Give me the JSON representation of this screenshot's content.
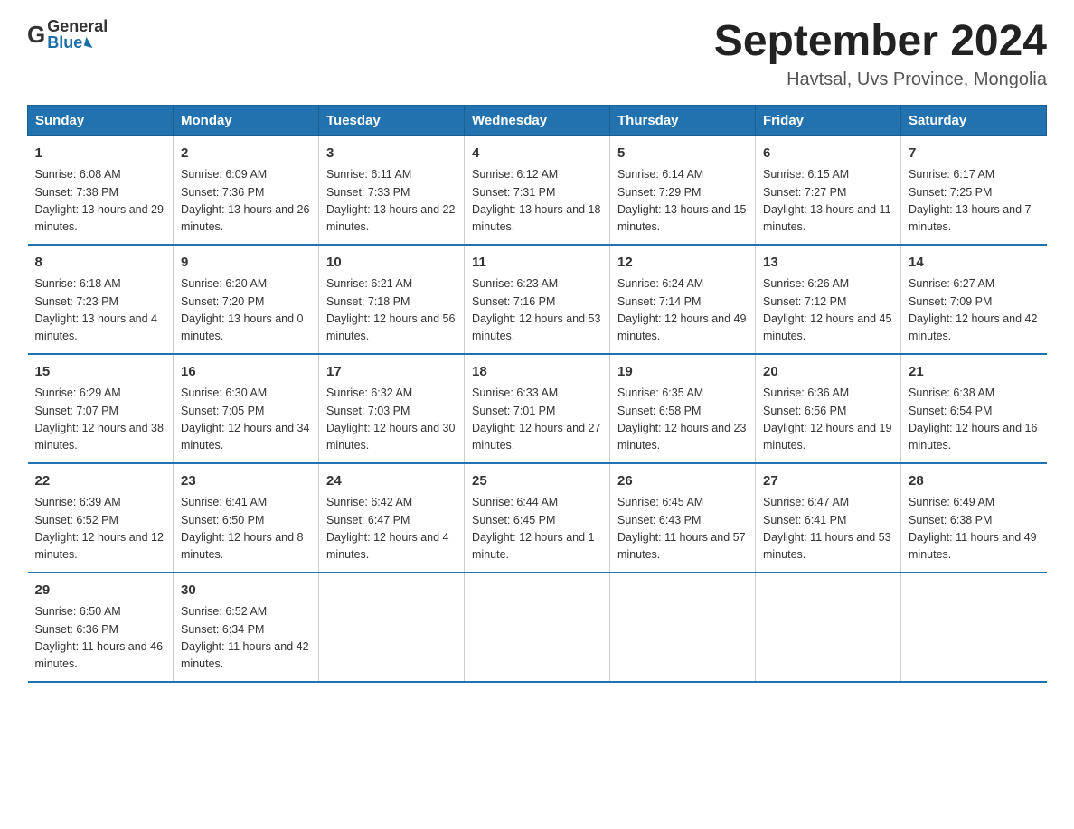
{
  "header": {
    "logo_general": "General",
    "logo_blue": "Blue",
    "month_title": "September 2024",
    "location": "Havtsal, Uvs Province, Mongolia"
  },
  "calendar": {
    "days_of_week": [
      "Sunday",
      "Monday",
      "Tuesday",
      "Wednesday",
      "Thursday",
      "Friday",
      "Saturday"
    ],
    "weeks": [
      [
        {
          "day": "1",
          "sunrise": "6:08 AM",
          "sunset": "7:38 PM",
          "daylight": "13 hours and 29 minutes."
        },
        {
          "day": "2",
          "sunrise": "6:09 AM",
          "sunset": "7:36 PM",
          "daylight": "13 hours and 26 minutes."
        },
        {
          "day": "3",
          "sunrise": "6:11 AM",
          "sunset": "7:33 PM",
          "daylight": "13 hours and 22 minutes."
        },
        {
          "day": "4",
          "sunrise": "6:12 AM",
          "sunset": "7:31 PM",
          "daylight": "13 hours and 18 minutes."
        },
        {
          "day": "5",
          "sunrise": "6:14 AM",
          "sunset": "7:29 PM",
          "daylight": "13 hours and 15 minutes."
        },
        {
          "day": "6",
          "sunrise": "6:15 AM",
          "sunset": "7:27 PM",
          "daylight": "13 hours and 11 minutes."
        },
        {
          "day": "7",
          "sunrise": "6:17 AM",
          "sunset": "7:25 PM",
          "daylight": "13 hours and 7 minutes."
        }
      ],
      [
        {
          "day": "8",
          "sunrise": "6:18 AM",
          "sunset": "7:23 PM",
          "daylight": "13 hours and 4 minutes."
        },
        {
          "day": "9",
          "sunrise": "6:20 AM",
          "sunset": "7:20 PM",
          "daylight": "13 hours and 0 minutes."
        },
        {
          "day": "10",
          "sunrise": "6:21 AM",
          "sunset": "7:18 PM",
          "daylight": "12 hours and 56 minutes."
        },
        {
          "day": "11",
          "sunrise": "6:23 AM",
          "sunset": "7:16 PM",
          "daylight": "12 hours and 53 minutes."
        },
        {
          "day": "12",
          "sunrise": "6:24 AM",
          "sunset": "7:14 PM",
          "daylight": "12 hours and 49 minutes."
        },
        {
          "day": "13",
          "sunrise": "6:26 AM",
          "sunset": "7:12 PM",
          "daylight": "12 hours and 45 minutes."
        },
        {
          "day": "14",
          "sunrise": "6:27 AM",
          "sunset": "7:09 PM",
          "daylight": "12 hours and 42 minutes."
        }
      ],
      [
        {
          "day": "15",
          "sunrise": "6:29 AM",
          "sunset": "7:07 PM",
          "daylight": "12 hours and 38 minutes."
        },
        {
          "day": "16",
          "sunrise": "6:30 AM",
          "sunset": "7:05 PM",
          "daylight": "12 hours and 34 minutes."
        },
        {
          "day": "17",
          "sunrise": "6:32 AM",
          "sunset": "7:03 PM",
          "daylight": "12 hours and 30 minutes."
        },
        {
          "day": "18",
          "sunrise": "6:33 AM",
          "sunset": "7:01 PM",
          "daylight": "12 hours and 27 minutes."
        },
        {
          "day": "19",
          "sunrise": "6:35 AM",
          "sunset": "6:58 PM",
          "daylight": "12 hours and 23 minutes."
        },
        {
          "day": "20",
          "sunrise": "6:36 AM",
          "sunset": "6:56 PM",
          "daylight": "12 hours and 19 minutes."
        },
        {
          "day": "21",
          "sunrise": "6:38 AM",
          "sunset": "6:54 PM",
          "daylight": "12 hours and 16 minutes."
        }
      ],
      [
        {
          "day": "22",
          "sunrise": "6:39 AM",
          "sunset": "6:52 PM",
          "daylight": "12 hours and 12 minutes."
        },
        {
          "day": "23",
          "sunrise": "6:41 AM",
          "sunset": "6:50 PM",
          "daylight": "12 hours and 8 minutes."
        },
        {
          "day": "24",
          "sunrise": "6:42 AM",
          "sunset": "6:47 PM",
          "daylight": "12 hours and 4 minutes."
        },
        {
          "day": "25",
          "sunrise": "6:44 AM",
          "sunset": "6:45 PM",
          "daylight": "12 hours and 1 minute."
        },
        {
          "day": "26",
          "sunrise": "6:45 AM",
          "sunset": "6:43 PM",
          "daylight": "11 hours and 57 minutes."
        },
        {
          "day": "27",
          "sunrise": "6:47 AM",
          "sunset": "6:41 PM",
          "daylight": "11 hours and 53 minutes."
        },
        {
          "day": "28",
          "sunrise": "6:49 AM",
          "sunset": "6:38 PM",
          "daylight": "11 hours and 49 minutes."
        }
      ],
      [
        {
          "day": "29",
          "sunrise": "6:50 AM",
          "sunset": "6:36 PM",
          "daylight": "11 hours and 46 minutes."
        },
        {
          "day": "30",
          "sunrise": "6:52 AM",
          "sunset": "6:34 PM",
          "daylight": "11 hours and 42 minutes."
        },
        null,
        null,
        null,
        null,
        null
      ]
    ]
  }
}
